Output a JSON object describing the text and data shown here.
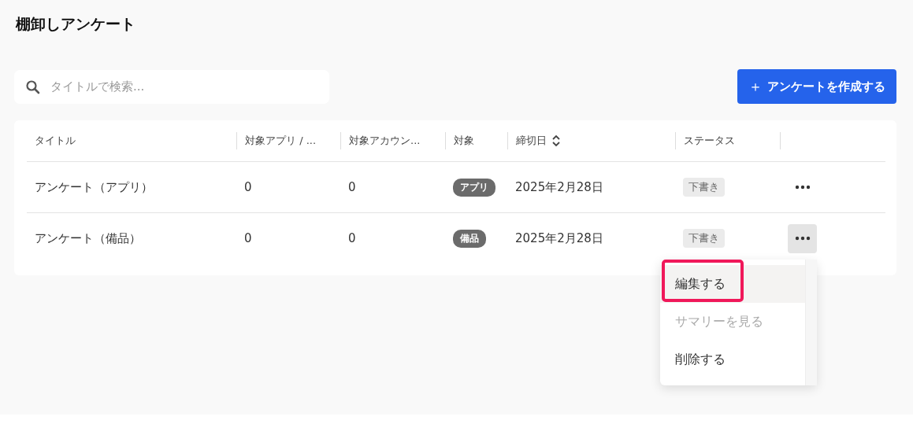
{
  "page_title": "棚卸しアンケート",
  "search": {
    "placeholder": "タイトルで検索..."
  },
  "create_button": {
    "icon": "＋",
    "label": "アンケートを作成する"
  },
  "table": {
    "columns": [
      {
        "label": "タイトル",
        "sortable": false
      },
      {
        "label": "対象アプリ / ...",
        "sortable": false
      },
      {
        "label": "対象アカウン...",
        "sortable": false
      },
      {
        "label": "対象",
        "sortable": false
      },
      {
        "label": "締切日",
        "sortable": true
      },
      {
        "label": "ステータス",
        "sortable": false
      }
    ],
    "rows": [
      {
        "title": "アンケート（アプリ）",
        "apps": "0",
        "accounts": "0",
        "target": "アプリ",
        "deadline": "2025年2月28日",
        "status": "下書き",
        "menu_open": false
      },
      {
        "title": "アンケート（備品）",
        "apps": "0",
        "accounts": "0",
        "target": "備品",
        "deadline": "2025年2月28日",
        "status": "下書き",
        "menu_open": true
      }
    ]
  },
  "row_menu": {
    "items": [
      {
        "label": "編集する",
        "hovered": true,
        "disabled": false,
        "highlighted": true
      },
      {
        "label": "サマリーを見る",
        "hovered": false,
        "disabled": true,
        "highlighted": false
      },
      {
        "label": "削除する",
        "hovered": false,
        "disabled": false,
        "highlighted": false
      }
    ]
  }
}
